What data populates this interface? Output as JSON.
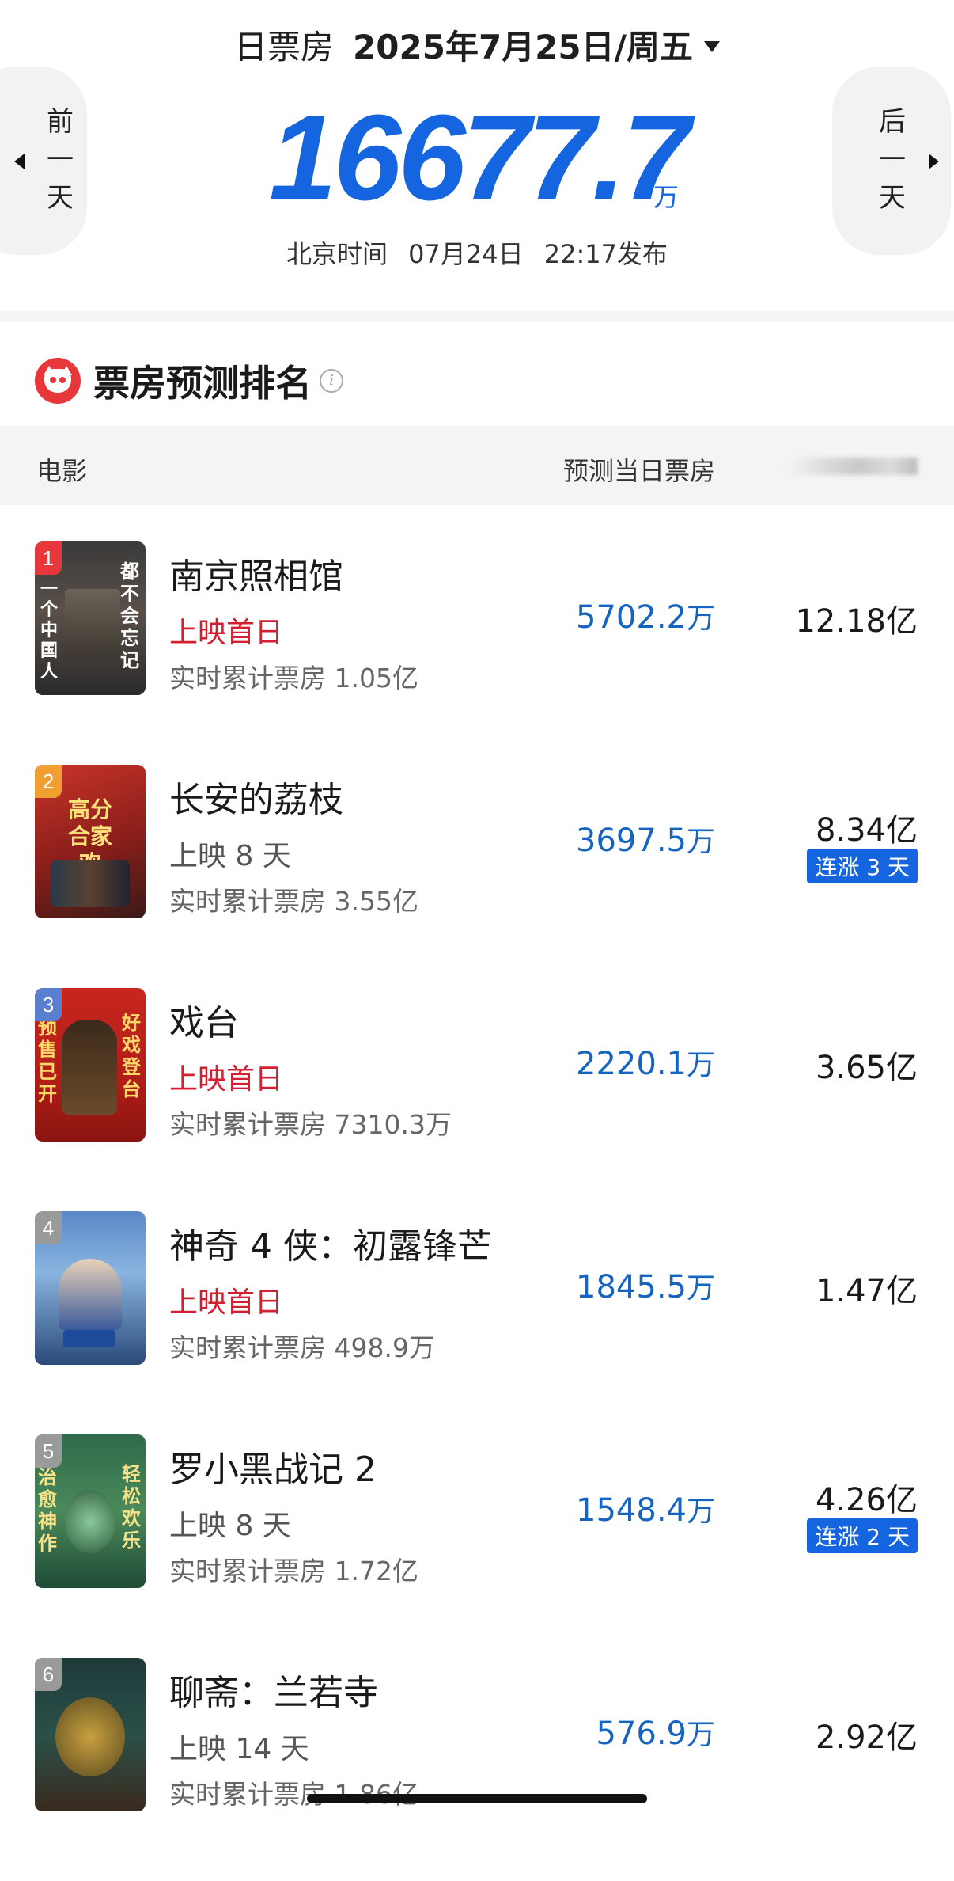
{
  "header": {
    "label": "日票房",
    "date": "2025年7月25日/周五",
    "prev_label": "前一天",
    "next_label": "后一天",
    "total_value": "16677.7",
    "total_unit": "万",
    "publish_prefix": "北京时间",
    "publish_date": "07月24日",
    "publish_time": "22:17发布"
  },
  "section": {
    "title": "票房预测排名",
    "info_icon": "info-icon",
    "col_movie": "电影",
    "col_daily": "预测当日票房"
  },
  "movies": [
    {
      "rank": "1",
      "title": "南京照相馆",
      "status": "上映首日",
      "cumulative": "实时累计票房 1.05亿",
      "daily": "5702.2",
      "daily_unit": "万",
      "total": "12.18亿",
      "badge": ""
    },
    {
      "rank": "2",
      "title": "长安的荔枝",
      "status": "上映 8 天",
      "cumulative": "实时累计票房 3.55亿",
      "daily": "3697.5",
      "daily_unit": "万",
      "total": "8.34亿",
      "badge": "连涨 3 天"
    },
    {
      "rank": "3",
      "title": "戏台",
      "status": "上映首日",
      "cumulative": "实时累计票房 7310.3万",
      "daily": "2220.1",
      "daily_unit": "万",
      "total": "3.65亿",
      "badge": ""
    },
    {
      "rank": "4",
      "title": "神奇 4 侠：初露锋芒",
      "status": "上映首日",
      "cumulative": "实时累计票房 498.9万",
      "daily": "1845.5",
      "daily_unit": "万",
      "total": "1.47亿",
      "badge": ""
    },
    {
      "rank": "5",
      "title": "罗小黑战记 2",
      "status": "上映 8 天",
      "cumulative": "实时累计票房 1.72亿",
      "daily": "1548.4",
      "daily_unit": "万",
      "total": "4.26亿",
      "badge": "连涨 2 天"
    },
    {
      "rank": "6",
      "title": "聊斋：兰若寺",
      "status": "上映 14 天",
      "cumulative": "实时累计票房 1.86亿",
      "daily": "576.9",
      "daily_unit": "万",
      "total": "2.92亿",
      "badge": ""
    }
  ],
  "posters": {
    "p1_right": "都不会忘记",
    "p1_left": "一个中国人",
    "p2_text": "高分合家欢",
    "p3_left": "预售已开",
    "p3_right": "好戏登台",
    "p5_left": "治愈神作",
    "p5_right": "轻松欢乐"
  },
  "colors": {
    "accent_blue": "#1565e0",
    "first_day_red": "#d31f2f",
    "rank_colors": [
      "#e8373a",
      "#f0a030",
      "#5a7fd0",
      "#9a9a9a",
      "#9a9a9a",
      "#9a9a9a"
    ]
  }
}
